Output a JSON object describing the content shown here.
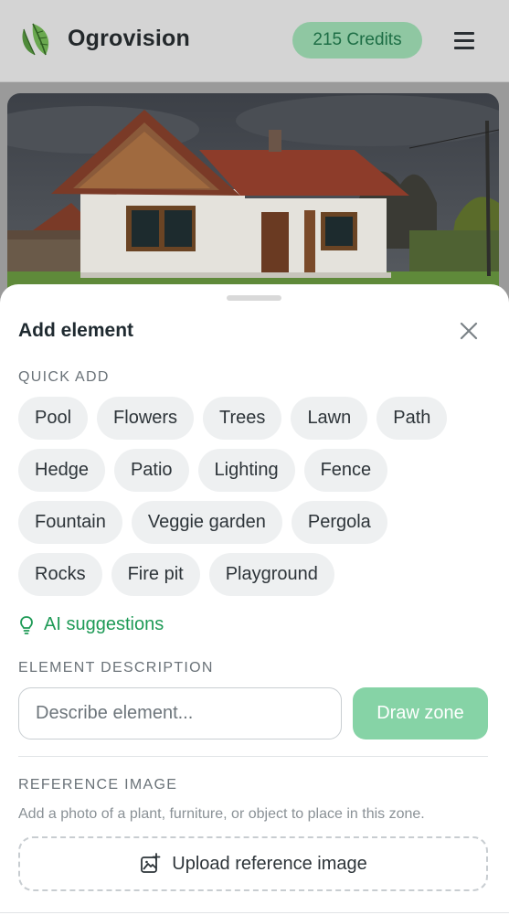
{
  "header": {
    "brand": "Ogrovision",
    "credits": "215 Credits",
    "icons": {
      "logo": "leaf-logo-icon",
      "menu": "hamburger-menu-icon"
    }
  },
  "photo": {
    "subject": "house-photo"
  },
  "sheet": {
    "title": "Add element",
    "close_icon": "close-icon",
    "quick_add_label": "QUICK ADD",
    "quick_add_items": [
      [
        "Pool",
        "Flowers",
        "Trees",
        "Lawn",
        "Path"
      ],
      [
        "Hedge",
        "Patio",
        "Lighting",
        "Fence"
      ],
      [
        "Fountain",
        "Veggie garden",
        "Pergola"
      ],
      [
        "Rocks",
        "Fire pit",
        "Playground"
      ]
    ],
    "ai_suggestions": "AI suggestions",
    "element_description_label": "ELEMENT DESCRIPTION",
    "description_placeholder": "Describe element...",
    "draw_zone": "Draw zone",
    "reference_image_label": "REFERENCE IMAGE",
    "reference_hint": "Add a photo of a plant, furniture, or object to place in this zone.",
    "upload_label": "Upload reference image"
  },
  "colors": {
    "accent_green": "#1e9a56",
    "credits_bg": "#8fc7a2",
    "draw_zone_bg": "#86d3a6"
  }
}
